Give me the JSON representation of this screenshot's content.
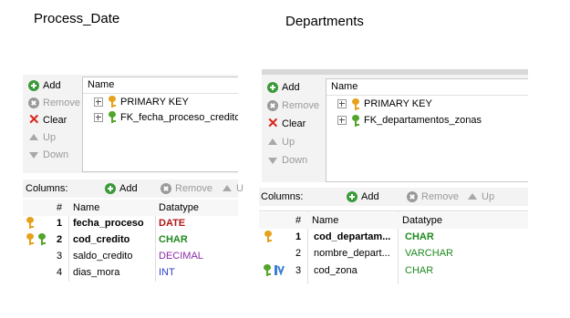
{
  "left": {
    "caption": "Process_Date",
    "buttons": {
      "add": "Add",
      "remove": "Remove",
      "clear": "Clear",
      "up": "Up",
      "down": "Down"
    },
    "keys_tree": {
      "header": "Name",
      "items": [
        {
          "label": "PRIMARY KEY",
          "icon": "gold-key-icon"
        },
        {
          "label": "FK_fecha_proceso_creditos",
          "icon": "green-key-icon"
        }
      ]
    },
    "columns_toolbar": {
      "label": "Columns:",
      "add": "Add",
      "remove": "Remove",
      "up": "U"
    },
    "columns_grid": {
      "headers": {
        "num": "#",
        "name": "Name",
        "datatype": "Datatype"
      },
      "rows": [
        {
          "num": "1",
          "name": "fecha_proceso",
          "datatype": "DATE",
          "icons": [
            "gold-key-icon"
          ]
        },
        {
          "num": "2",
          "name": "cod_credito",
          "datatype": "CHAR",
          "icons": [
            "gold-key-icon",
            "green-key-icon"
          ]
        },
        {
          "num": "3",
          "name": "saldo_credito",
          "datatype": "DECIMAL",
          "icons": []
        },
        {
          "num": "4",
          "name": "dias_mora",
          "datatype": "INT",
          "icons": []
        }
      ]
    }
  },
  "right": {
    "caption": "Departments",
    "buttons": {
      "add": "Add",
      "remove": "Remove",
      "clear": "Clear",
      "up": "Up",
      "down": "Down"
    },
    "keys_tree": {
      "header": "Name",
      "items": [
        {
          "label": "PRIMARY KEY",
          "icon": "gold-key-icon"
        },
        {
          "label": "FK_departamentos_zonas",
          "icon": "green-key-icon"
        }
      ]
    },
    "columns_toolbar": {
      "label": "Columns:",
      "add": "Add",
      "remove": "Remove",
      "up": "Up"
    },
    "columns_grid": {
      "headers": {
        "num": "#",
        "name": "Name",
        "datatype": "Datatype"
      },
      "rows": [
        {
          "num": "1",
          "name": "cod_departam...",
          "datatype": "CHAR",
          "icons": [
            "gold-key-icon"
          ]
        },
        {
          "num": "2",
          "name": "nombre_depart...",
          "datatype": "VARCHAR",
          "icons": []
        },
        {
          "num": "3",
          "name": "cod_zona",
          "datatype": "CHAR",
          "icons": [
            "green-key-icon",
            "index-icon"
          ]
        }
      ]
    }
  }
}
